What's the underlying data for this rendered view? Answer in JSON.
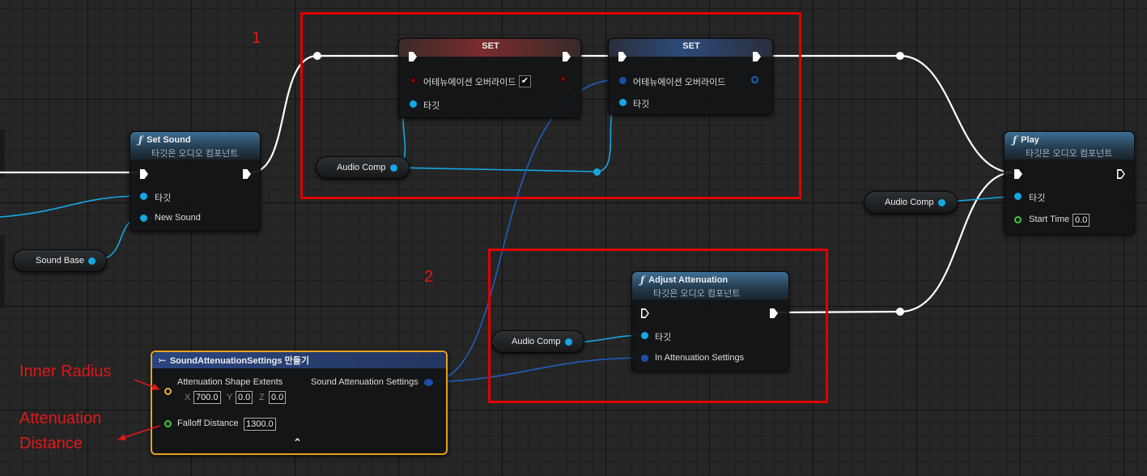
{
  "nodes": {
    "set_sound": {
      "title": "Set Sound",
      "subtitle": "타깃은 오디오 컴포넌트",
      "pin_target": "타깃",
      "pin_new_sound": "New Sound"
    },
    "set1": {
      "title": "SET",
      "pin_override": "어테뉴에이션 오버라이드",
      "override_checked": "✔",
      "pin_target": "타깃"
    },
    "set2": {
      "title": "SET",
      "pin_override": "어테뉴에이션 오버라이드",
      "pin_target": "타깃"
    },
    "play": {
      "title": "Play",
      "subtitle": "타깃은 오디오 컴포넌트",
      "pin_target": "타깃",
      "pin_start_time": "Start Time",
      "start_time_value": "0.0"
    },
    "adjust": {
      "title": "Adjust Attenuation",
      "subtitle": "타깃은 오디오 컴포넌트",
      "pin_target": "타깃",
      "pin_settings": "In Attenuation Settings"
    },
    "make_settings": {
      "title": "SoundAttenuationSettings 만들기",
      "pin_extents": "Attenuation Shape Extents",
      "x_label": "X",
      "x_value": "700.0",
      "y_label": "Y",
      "y_value": "0.0",
      "z_label": "Z",
      "z_value": "0.0",
      "pin_falloff": "Falloff Distance",
      "falloff_value": "1300.0",
      "out_settings": "Sound Attenuation Settings",
      "collapse_glyph": "⌃"
    }
  },
  "variables": {
    "sound_base": "Sound Base",
    "audio_comp_1": "Audio Comp",
    "audio_comp_2": "Audio Comp",
    "audio_comp_3": "Audio Comp"
  },
  "annotations": {
    "box1_label": "1",
    "box2_label": "2",
    "inner_radius": "Inner Radius",
    "attenuation_line1": "Attenuation",
    "attenuation_line2": "Distance"
  },
  "colors": {
    "exec_wire": "#ffffff",
    "object_wire": "#15a7e3",
    "struct_wire": "#1f5fbf",
    "annotation_red": "#e00000"
  }
}
